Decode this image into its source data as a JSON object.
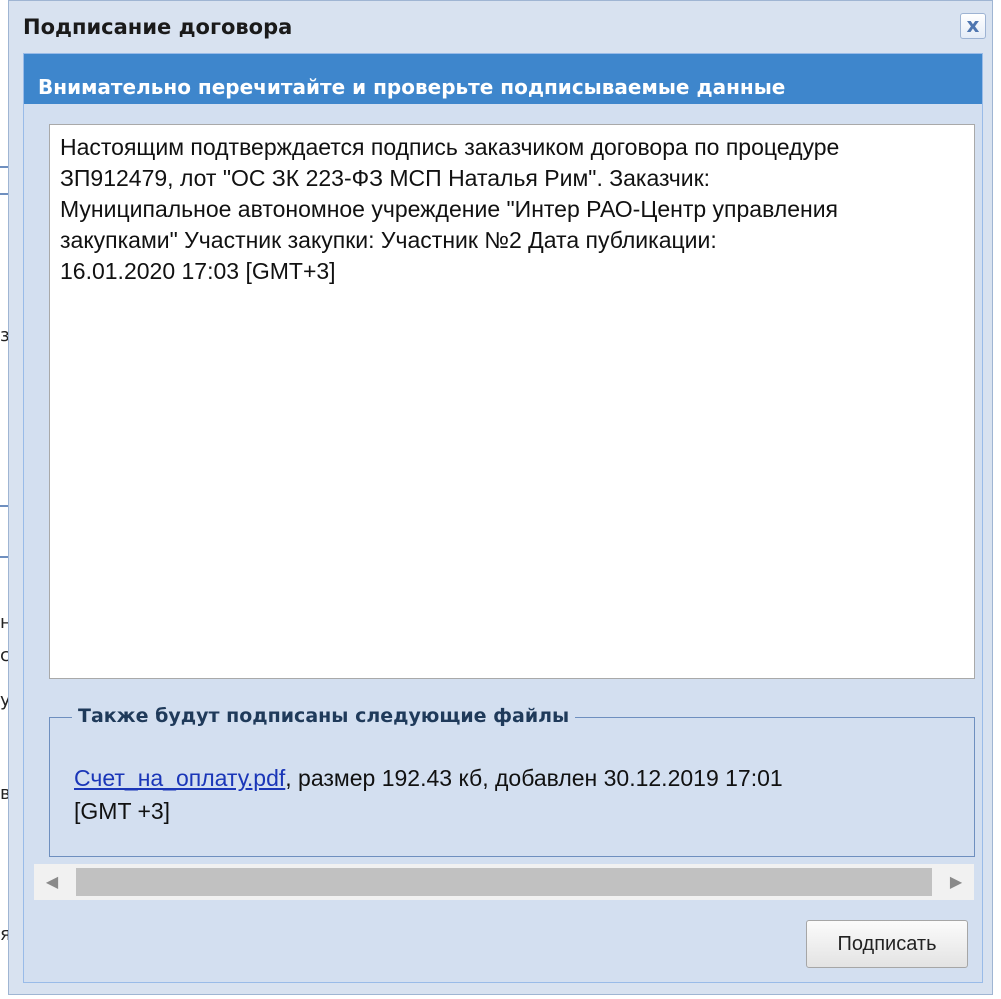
{
  "window": {
    "title": "Подписание договора",
    "close_icon": "close-icon",
    "close_glyph": "x"
  },
  "panel": {
    "title": "Внимательно перечитайте и проверьте подписываемые данные"
  },
  "document": {
    "lines": [
      "Настоящим подтверждается подпись заказчиком договора по процедуре",
      "ЗП912479, лот \"ОС ЗК 223-ФЗ  МСП Наталья Рим\". Заказчик:",
      "Муниципальное автономное учреждение \"Интер РАО-Центр управления",
      "закупками\" Участник закупки: Участник №2 Дата публикации:",
      "16.01.2020 17:03 [GMT+3]"
    ]
  },
  "files": {
    "legend": "Также будут подписаны следующие файлы",
    "items": [
      {
        "name": "Счет_на_оплату.pdf",
        "details": ", размер 192.43 кб, добавлен 30.12.2019 17:01",
        "details_line2": "[GMT +3]"
      }
    ]
  },
  "scrollbar": {
    "left_arrow": "◀",
    "right_arrow": "▶"
  },
  "actions": {
    "sign_label": "Подписать"
  },
  "background": {
    "edge_chars": [
      "з",
      "н",
      "с",
      "у",
      "в",
      "я"
    ]
  },
  "colors": {
    "panel_header": "#3e86cc",
    "window_bg": "#d8e2f0",
    "link": "#1a36b8"
  }
}
